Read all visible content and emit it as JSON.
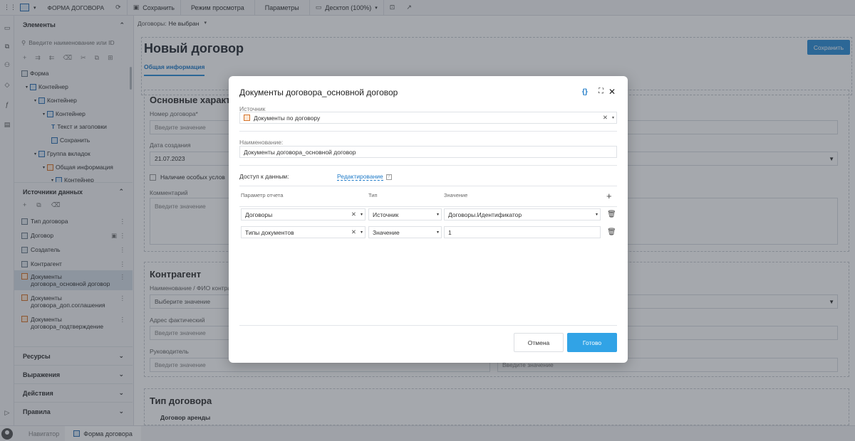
{
  "topbar": {
    "form_title": "ФОРМА ДОГОВОРА",
    "save": "Сохранить",
    "view_mode": "Режим просмотра",
    "params": "Параметры",
    "desktop": "Десктоп (100%)"
  },
  "sidebar": {
    "elements_title": "Элементы",
    "search_placeholder": "Введите наименование или ID",
    "tree": [
      "Форма",
      "Контейнер",
      "Контейнер",
      "Контейнер",
      "Текст и заголовки",
      "Сохранить",
      "Группа вкладок",
      "Общая информация",
      "Контейнер"
    ],
    "sources_title": "Источники данных",
    "sources": [
      "Тип договора",
      "Договор",
      "Создатель",
      "Контрагент",
      "Документы договора_основной договор",
      "Документы договора_доп.соглашения",
      "Документы договора_подтверждение"
    ],
    "accordions": [
      "Ресурсы",
      "Выражения",
      "Действия",
      "Правила"
    ]
  },
  "bottombar": {
    "navigator": "Навигатор",
    "form_tab": "Форма договора"
  },
  "canvas": {
    "contracts_label": "Договоры:",
    "contracts_value": "Не выбран",
    "page_title": "Новый договор",
    "save_button": "Сохранить",
    "tab_general": "Общая информация",
    "section_main": "Основные характери",
    "contract_number_label": "Номер договора*",
    "enter_value": "Введите значение",
    "creation_date_label": "Дата создания",
    "creation_date_value": "21.07.2023",
    "special_conditions": "Наличие особых услов",
    "comment_label": "Комментарий",
    "section_contractor": "Контрагент",
    "contractor_name_label": "Наименование / ФИО контраг",
    "select_value": "Выберите значение",
    "actual_address_label": "Адрес фактический",
    "director_label": "Руководитель",
    "section_contract_type": "Тип договора",
    "contract_type_lease": "Договор аренды"
  },
  "modal": {
    "title": "Документы договора_основной договор",
    "source_label": "Источник",
    "source_value": "Документы по договору",
    "name_label": "Наименование:",
    "name_value": "Документы договора_основной договор",
    "access_label": "Доступ к данным:",
    "access_value": "Редактирование",
    "col_param": "Параметр отчета",
    "col_type": "Тип",
    "col_value": "Значение",
    "rows": [
      {
        "param": "Договоры",
        "type": "Источник",
        "value": "Договоры.Идентификатор"
      },
      {
        "param": "Типы документов",
        "type": "Значение",
        "value": "1"
      }
    ],
    "cancel": "Отмена",
    "done": "Готово"
  },
  "colors": {
    "accent": "#2f8fd8",
    "primary_button": "#31a3e6",
    "link": "#1f7bc8"
  }
}
